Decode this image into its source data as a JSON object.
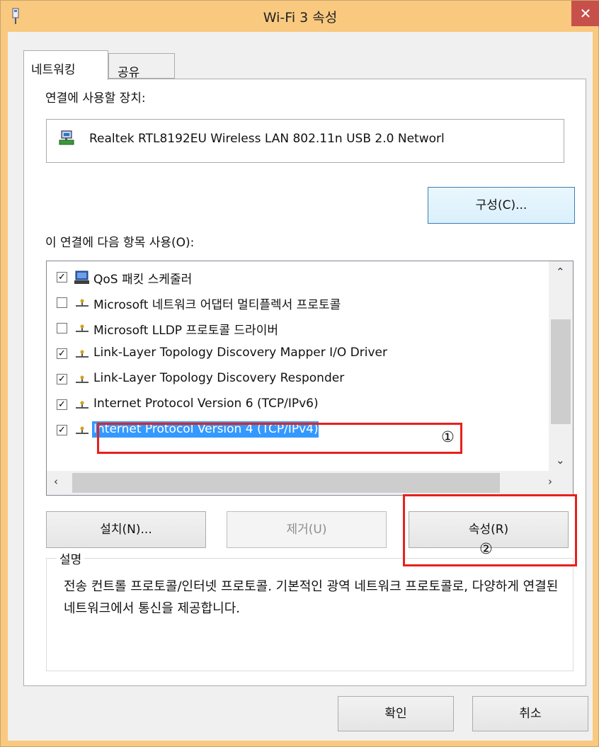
{
  "window": {
    "title": "Wi-Fi 3 속성",
    "close_label": "✕"
  },
  "tabs": [
    {
      "label": "네트워킹",
      "active": true
    },
    {
      "label": "공유",
      "active": false
    }
  ],
  "connect_using": {
    "label": "연결에 사용할 장치:",
    "device": "Realtek RTL8192EU Wireless LAN 802.11n USB 2.0 Networl",
    "configure_button": "구성(C)..."
  },
  "items_section": {
    "label": "이 연결에 다음 항목 사용(O):",
    "items": [
      {
        "label": "QoS 패킷 스케줄러",
        "checked": true,
        "icon": "scheduler-icon",
        "selected": false
      },
      {
        "label": "Microsoft 네트워크 어댑터 멀티플렉서 프로토콜",
        "checked": false,
        "icon": "protocol-icon",
        "selected": false
      },
      {
        "label": "Microsoft LLDP 프로토콜 드라이버",
        "checked": false,
        "icon": "protocol-icon",
        "selected": false
      },
      {
        "label": "Link-Layer Topology Discovery Mapper I/O Driver",
        "checked": true,
        "icon": "protocol-icon",
        "selected": false
      },
      {
        "label": "Link-Layer Topology Discovery Responder",
        "checked": true,
        "icon": "protocol-icon",
        "selected": false
      },
      {
        "label": "Internet Protocol Version 6 (TCP/IPv6)",
        "checked": true,
        "icon": "protocol-icon",
        "selected": false
      },
      {
        "label": "Internet Protocol Version 4 (TCP/IPv4)",
        "checked": true,
        "icon": "protocol-icon",
        "selected": true
      }
    ]
  },
  "buttons": {
    "install": "설치(N)...",
    "uninstall": "제거(U)",
    "properties": "속성(R)",
    "ok": "확인",
    "cancel": "취소"
  },
  "description": {
    "title": "설명",
    "text": "전송 컨트롤 프로토콜/인터넷 프로토콜. 기본적인 광역 네트워크 프로토콜로, 다양하게 연결된 네트워크에서 통신을 제공합니다."
  },
  "annotations": {
    "marker_1": "①",
    "marker_2": "②",
    "highlight_color": "#e8201c"
  },
  "colors": {
    "titlebar": "#f9c97f",
    "close": "#c7504a",
    "selection": "#3399ff"
  }
}
